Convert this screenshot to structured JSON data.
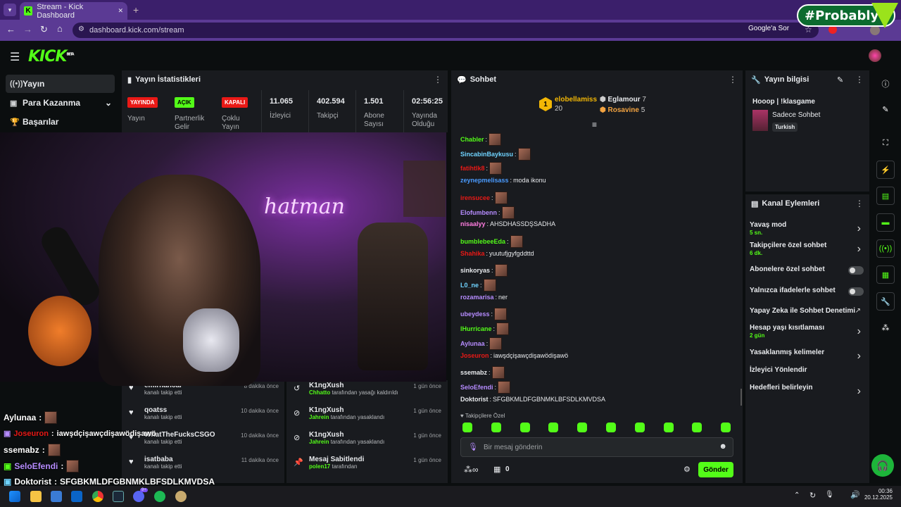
{
  "browser": {
    "tab_title": "Stream - Kick Dashboard",
    "url": "dashboard.kick.com/stream",
    "google_label": "Google'a Sor",
    "tab_close": "✕",
    "new_tab": "+"
  },
  "watermark": "#Probably",
  "app": {
    "logo": "KICK",
    "beta": "BETA",
    "sidebar": [
      {
        "label": "Yayın",
        "icon": "broadcast-icon"
      },
      {
        "label": "Para Kazanma",
        "icon": "money-icon"
      },
      {
        "label": "Başarılar",
        "icon": "trophy-icon"
      }
    ]
  },
  "stats": {
    "title": "Yayın İstatistikleri",
    "items": [
      {
        "badge": "YAYINDA",
        "badge_color": "#e91916",
        "label": "Yayın"
      },
      {
        "badge": "AÇIK",
        "badge_color": "#53fc18",
        "label": "Partnerlik Gelir"
      },
      {
        "badge": "KAPALI",
        "badge_color": "#e91916",
        "label": "Çoklu Yayın"
      },
      {
        "value": "11.065",
        "label": "İzleyici"
      },
      {
        "value": "402.594",
        "label": "Takipçi"
      },
      {
        "value": "1.501",
        "label": "Abone Sayısı"
      },
      {
        "value": "02:56:25",
        "label": "Yayında Olduğu"
      }
    ]
  },
  "video": {
    "neon_sign": "hatman"
  },
  "activity_left": [
    {
      "name": "emirhancal",
      "sub": "kanalı takip etti",
      "time": "8 dakika önce"
    },
    {
      "name": "qoatss",
      "sub": "kanalı takip etti",
      "time": "10 dakika önce"
    },
    {
      "name": "WhatTheFucksCSGO",
      "sub": "kanalı takip etti",
      "time": "10 dakika önce"
    },
    {
      "name": "isatbaba",
      "sub": "kanalı takip etti",
      "time": "11 dakika önce"
    }
  ],
  "activity_right": [
    {
      "name": "K1ngXush",
      "actor": "Chhatto",
      "sub": "tarafından yasağı kaldırıldı",
      "time": "1 gün önce"
    },
    {
      "name": "K1ngXush",
      "actor": "Jahrein",
      "sub": "tarafından yasaklandı",
      "time": "1 gün önce"
    },
    {
      "name": "K1ngXush",
      "actor": "Jahrein",
      "sub": "tarafından yasaklandı",
      "time": "1 gün önce"
    },
    {
      "name": "Mesaj Sabitlendi",
      "actor": "polen17",
      "sub": "tarafından",
      "time": "1 gün önce"
    }
  ],
  "overlay_chat": [
    {
      "user": "Aylunaa",
      "text": "",
      "color": "#ffffff"
    },
    {
      "user": "Joseuron",
      "text": "iawşdçişawçdişawödişawö",
      "color": "#e91916"
    },
    {
      "user": "ssemabz",
      "text": "",
      "color": "#ffffff"
    },
    {
      "user": "SeloEfendi",
      "text": "",
      "color": "#b68cff"
    },
    {
      "user": "Doktorist",
      "text": "SFGBKMLDFGBNMKLBFSDLKMVDSA",
      "color": "#ffffff"
    }
  ],
  "chat": {
    "title": "Sohbet",
    "leaderboard": {
      "first": {
        "rank": "1",
        "name": "elobellamiss",
        "count": "20"
      },
      "second": {
        "name": "Eglamour",
        "count": "7"
      },
      "third": {
        "name": "Rosavine",
        "count": "5"
      }
    },
    "messages": [
      {
        "user": "Chabler",
        "color": "#53fc18",
        "text": ""
      },
      {
        "user": "SincabinBaykusu",
        "color": "#6fd3ff",
        "text": ""
      },
      {
        "user": "fatihtlk8",
        "color": "#e91916",
        "text": ""
      },
      {
        "user": "zeynepmelisass",
        "color": "#4a9bff",
        "text": "moda ikonu"
      },
      {
        "user": "irensucee",
        "color": "#e91916",
        "text": ""
      },
      {
        "user": "Elofumbenn",
        "color": "#b68cff",
        "text": ""
      },
      {
        "user": "nisaalyy",
        "color": "#ff7de0",
        "text": "AHSDHASSDŞSADHA"
      },
      {
        "user": "bumblebeeEda",
        "color": "#53fc18",
        "text": ""
      },
      {
        "user": "Shahika",
        "color": "#e91916",
        "text": "yuutufjgyfgddttd"
      },
      {
        "user": "sinkoryas",
        "color": "#e8eaed",
        "text": ""
      },
      {
        "user": "L0_ne",
        "color": "#6fd3ff",
        "text": ""
      },
      {
        "user": "rozamarisa",
        "color": "#b68cff",
        "text": "ner"
      },
      {
        "user": "ubeydess",
        "color": "#b68cff",
        "text": ""
      },
      {
        "user": "lHurricane",
        "color": "#53fc18",
        "text": ""
      },
      {
        "user": "Aylunaa",
        "color": "#b68cff",
        "text": ""
      },
      {
        "user": "Joseuron",
        "color": "#e91916",
        "text": "iawşdçişawçdişawödişawö"
      },
      {
        "user": "ssemabz",
        "color": "#e8eaed",
        "text": ""
      },
      {
        "user": "SeloEfendi",
        "color": "#b68cff",
        "text": ""
      },
      {
        "user": "Doktorist",
        "color": "#e8eaed",
        "text": "SFGBKMLDFGBNMKLBFSDLKMVDSA"
      }
    ],
    "followers_only": "Takipçilere Özel",
    "input_placeholder": "Bir mesaj gönderin",
    "points": "0",
    "send": "Gönder"
  },
  "stream_info": {
    "title": "Yayın bilgisi",
    "stream_title": "Hooop | !klasgame",
    "category": "Sadece Sohbet",
    "tag": "Turkish"
  },
  "channel_actions": {
    "title": "Kanal Eylemleri",
    "items": [
      {
        "label": "Yavaş mod",
        "sub": "5 sn.",
        "control": "chevron"
      },
      {
        "label": "Takipçilere özel sohbet",
        "sub": "6 dk.",
        "control": "chevron"
      },
      {
        "label": "Abonelere özel sohbet",
        "sub": "",
        "control": "toggle"
      },
      {
        "label": "Yalnızca ifadelerle sohbet",
        "sub": "",
        "control": "toggle"
      },
      {
        "label": "Yapay Zeka ile Sohbet Denetimi",
        "sub": "",
        "control": "external"
      },
      {
        "label": "Hesap yaşı kısıtlaması",
        "sub": "2 gün",
        "control": "chevron"
      },
      {
        "label": "Yasaklanmış kelimeler",
        "sub": "",
        "control": "chevron"
      },
      {
        "label": "İzleyici Yönlendir",
        "sub": "",
        "control": "none"
      },
      {
        "label": "Hedefleri belirleyin",
        "sub": "",
        "control": "chevron"
      }
    ]
  },
  "taskbar": {
    "time": "00:36",
    "date": "20.12.2025",
    "badge": "9+"
  }
}
